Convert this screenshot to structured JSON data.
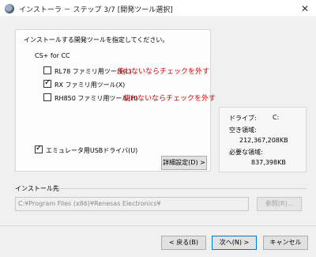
{
  "window": {
    "title": "インストーラ － ステップ 3/7 [開発ツール選択]",
    "close_glyph": "✕"
  },
  "select_panel": {
    "instruction": "インストールする開発ツールを指定してください。",
    "group_label": "CS+ for CC",
    "tools": [
      {
        "label": "RL78 ファミリ用ツール(L)",
        "checked": false,
        "note": "使わないならチェックを外す"
      },
      {
        "label": "RX ファミリ用ツール(X)",
        "checked": true,
        "note": ""
      },
      {
        "label": "RH850 ファミリ用ツール(H)",
        "checked": false,
        "note": "使わないならチェックを外す"
      }
    ],
    "emulator_usb_driver": {
      "label": "エミュレータ用USBドライバ(U)",
      "checked": true
    },
    "advanced_button": "詳細設定(D) >"
  },
  "disk_info": {
    "drive_label": "ドライブ:",
    "drive_value": "C:",
    "free_label": "空き領域:",
    "free_value": "212,367,208KB",
    "required_label": "必要な領域:",
    "required_value": "837,398KB"
  },
  "install_dest": {
    "label": "インストール先",
    "path": "C:¥Program Files (x86)¥Renesas Electronics¥",
    "browse_button": "参照(R)..."
  },
  "footer": {
    "back_button": "< 戻る(B)",
    "next_button": "次へ(N) >",
    "cancel_button": "キャンセル"
  }
}
